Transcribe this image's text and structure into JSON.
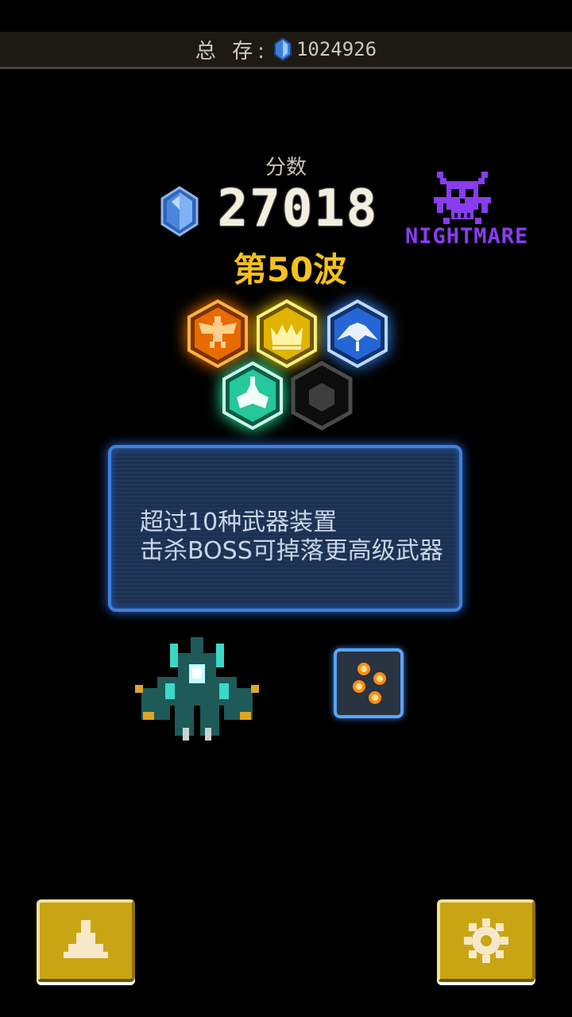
{
  "top_bar": {
    "label": "总 存:",
    "gem_icon": "blue-gem-icon",
    "total_gems": "1024926"
  },
  "score": {
    "label": "分数",
    "value": "27018",
    "gem_icon": "blue-gem-icon"
  },
  "wave": "第50波",
  "difficulty": {
    "icon": "purple-skull-icon",
    "label": "NIGHTMARE"
  },
  "medals": [
    {
      "name": "eagle-medal",
      "color": "#ff7a00"
    },
    {
      "name": "crown-medal",
      "color": "#ffd400"
    },
    {
      "name": "manta-medal",
      "color": "#2f7fff"
    },
    {
      "name": "ship-medal",
      "color": "#26c79a"
    },
    {
      "name": "locked-medal",
      "color": "#3a3a3a"
    }
  ],
  "info_panel": {
    "line1": "超过10种武器装置",
    "line2": "击杀BOSS可掉落更高级武器"
  },
  "powerup_icon": "orange-orbs-powerup-icon",
  "buttons": {
    "left": {
      "icon": "ship-icon"
    },
    "right": {
      "icon": "gear-icon"
    }
  },
  "colors": {
    "gold": "#f5c21a",
    "purple": "#8a3cf0",
    "panel_border": "#3f7fe0",
    "button": "#c9a514"
  }
}
